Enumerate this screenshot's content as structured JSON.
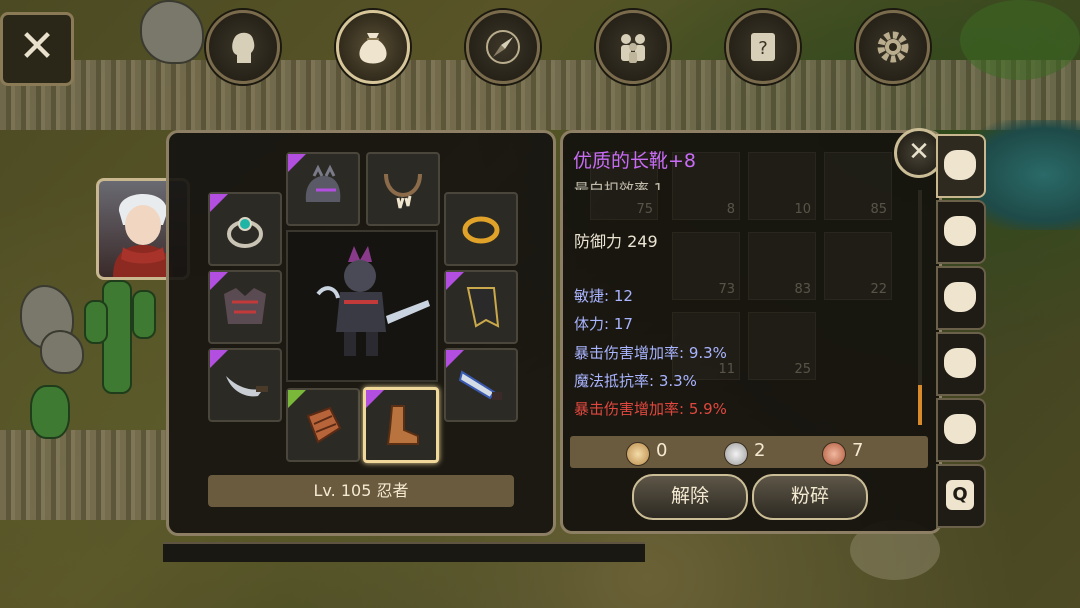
{
  "top_tabs": [
    {
      "icon": "head-silhouette-icon",
      "active": false
    },
    {
      "icon": "bag-icon",
      "active": true
    },
    {
      "icon": "compass-rose-icon",
      "active": false
    },
    {
      "icon": "party-icon",
      "active": false
    },
    {
      "icon": "quest-scroll-icon",
      "active": false
    },
    {
      "icon": "gear-icon",
      "active": false
    }
  ],
  "close_glyph": "✕",
  "character": {
    "level_label": "Lv. 105 忍者"
  },
  "item": {
    "title": "优质的长靴+8",
    "title_color": "#c96cf5",
    "cut_text": "最白扣效率 1",
    "main_stat": "防御力 249",
    "stats": [
      {
        "text": "敏捷: 12",
        "color": "blue"
      },
      {
        "text": "体力: 17",
        "color": "blue"
      },
      {
        "text": "暴击伤害增加率: 9.3%",
        "color": "blue"
      },
      {
        "text": "魔法抵抗率: 3.3%",
        "color": "blue"
      },
      {
        "text": "暴击伤害增加率: 5.9%",
        "color": "red"
      }
    ]
  },
  "currency": {
    "gold": "0",
    "silver": "2",
    "copper": "7"
  },
  "buttons": {
    "unequip": "解除",
    "smash": "粉碎"
  },
  "inventory_counts": [
    "75",
    "8",
    "10",
    "85",
    "73",
    "83",
    "22",
    "11",
    "25"
  ],
  "colors": {
    "rarity_purple": "#b34fe0",
    "rarity_green": "#7ab83a",
    "stat_blue": "#a9b4ff",
    "stat_red": "#e0483f"
  }
}
